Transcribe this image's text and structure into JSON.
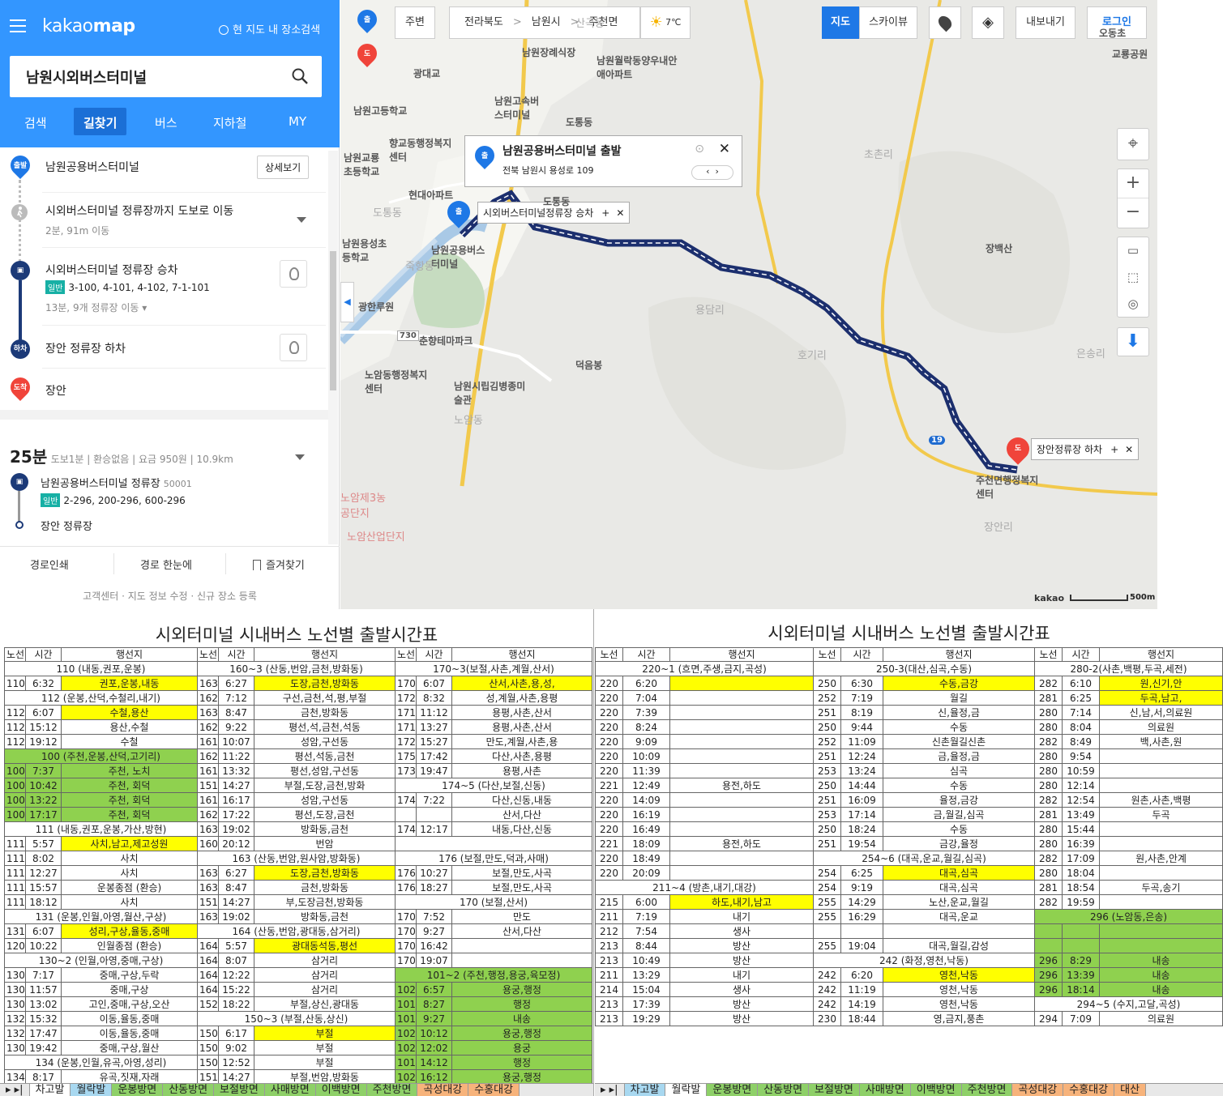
{
  "app": {
    "logo_light": "kakao",
    "logo_bold": "map",
    "here_search": "현 지도 내 장소검색"
  },
  "search": {
    "value": "남원시외버스터미널"
  },
  "tabs": [
    "검색",
    "길찾기",
    "버스",
    "지하철",
    "MY"
  ],
  "route_steps": {
    "start_badge": "출발",
    "start": "남원공용버스터미널",
    "detail_btn": "상세보기",
    "walk": "시외버스터미널 정류장까지 도보로 이동",
    "walk_sub": "2분, 91m 이동",
    "board_badge": "승차",
    "board": "시외버스터미널 정류장 승차",
    "board_type": "일반",
    "board_lines": "3-100,  4-101,  4-102,  7-1-101",
    "board_sub": "13분, 9개 정류장 이동",
    "alight_badge": "하차",
    "alight": "장안 정류장 하차",
    "end_badge": "도착",
    "end": "장안"
  },
  "alt_route": {
    "minutes": "25분",
    "summary": "도보1분 | 환승없음 | 요금 950원 | 10.9km",
    "stop": "남원공용버스터미널 정류장",
    "stop_id": "50001",
    "type": "일반",
    "lines": "2-296, 200-296, 600-296",
    "dest": "장안 정류장"
  },
  "footer": {
    "print": "경로인쇄",
    "overview": "경로 한눈에",
    "fav": "즐겨찾기",
    "links": "고객센터 · 지도 정보 수정 · 신규 장소 등록"
  },
  "map": {
    "btn_start": "출",
    "btn_end": "도",
    "nearby": "주변",
    "crumbs": [
      "전라북도",
      "남원시",
      "주천면"
    ],
    "temp": "7℃",
    "map": "지도",
    "sky": "스카이뷰",
    "export": "내보내기",
    "login": "로그인",
    "popup_title": "남원공용버스터미널 출발",
    "popup_addr": "전북 남원시 용성로 109",
    "tag_board": "시외버스터미널정류장 승차",
    "tag_alight": "장안정류장 하차",
    "labels": [
      "남원장례식장",
      "남원월락동양우내안애아파트",
      "광대교",
      "남원고속버스터미널",
      "남원고등학교",
      "향교동행정복지센터",
      "남원교룡초등학교",
      "도통동",
      "현대아파트",
      "남원용성초등학교",
      "남원공용버스터미널",
      "광한루원",
      "춘향테마파크",
      "노암동행정복지센터",
      "남원시립김병종미술관",
      "덕음봉",
      "용담리",
      "호기리",
      "장백산",
      "주천면행정복지센터",
      "장안리",
      "노암동",
      "도통동",
      "초촌리",
      "오동초",
      "교룡공원",
      "은송리",
      "도통동",
      "죽항동",
      "산곡동",
      "노암제3농공단지",
      "노암산업단지",
      "730",
      "19"
    ],
    "scale": "500m",
    "brand": "kakao"
  },
  "sheets": [
    {
      "title": "시외터미널 시내버스 노선별 출발시간표",
      "tabs": [
        "차고발",
        "월락발",
        "운봉방면",
        "산동방면",
        "보절방면",
        "사매방면",
        "이백방면",
        "주천방면",
        "곡성대강",
        "수홍대강"
      ]
    },
    {
      "title": "시외터미널 시내버스 노선별 출발시간표",
      "tabs": [
        "차고발",
        "월락발",
        "운봉방면",
        "산동방면",
        "보절방면",
        "사매방면",
        "이백방면",
        "주천방면",
        "곡성대강",
        "수홍대강",
        "대산"
      ]
    }
  ],
  "col_headers": [
    "노선",
    "시간",
    "행선지"
  ],
  "t1": [
    [
      "110 (내동,권포,운봉)"
    ],
    [
      "110",
      "6:32",
      "권포,운봉,내동",
      "y"
    ],
    [
      "112 (운봉,산덕,수철리,내기)"
    ],
    [
      "112",
      "6:07",
      "수철,용산",
      "y"
    ],
    [
      "112",
      "15:12",
      "용산,수철"
    ],
    [
      "112",
      "19:12",
      "수철"
    ],
    [
      "100 (주천,운봉,산덕,고기리)",
      "",
      "",
      "g"
    ],
    [
      "100",
      "7:37",
      "주천, 노치",
      "g"
    ],
    [
      "100",
      "10:42",
      "주천, 회덕",
      "g"
    ],
    [
      "100",
      "13:22",
      "주천, 회덕",
      "g"
    ],
    [
      "100",
      "17:17",
      "주천, 회덕",
      "g"
    ],
    [
      "111 (내동,권포,운봉,가산,방현)"
    ],
    [
      "111",
      "5:57",
      "사치,남고,제고성원",
      "y"
    ],
    [
      "111",
      "8:02",
      "사치"
    ],
    [
      "111",
      "12:27",
      "사치"
    ],
    [
      "111",
      "15:57",
      "운봉종점 (환승)"
    ],
    [
      "111",
      "18:12",
      "사치"
    ],
    [
      "131 (운봉,인월,아영,월산,구상)"
    ],
    [
      "131",
      "6:07",
      "성리,구상,율동,중매",
      "y"
    ],
    [
      "120",
      "10:22",
      "인월종점 (환승)"
    ],
    [
      "130~2 (인월,아영,중매,구상)"
    ],
    [
      "130",
      "7:17",
      "중매,구상,두락"
    ],
    [
      "130",
      "11:57",
      "중매,구상"
    ],
    [
      "130",
      "13:02",
      "고인,중매,구상,오산"
    ],
    [
      "132",
      "15:32",
      "이동,율동,중매"
    ],
    [
      "132",
      "17:47",
      "이동,율동,중매"
    ],
    [
      "130",
      "19:42",
      "중매,구상,월산"
    ],
    [
      "134 (운봉,인월,유곡,아영,성리)"
    ],
    [
      "134",
      "8:17",
      "유곡,짓재,자래"
    ]
  ],
  "t2": [
    [
      "160~3 (산동,번암,금천,방화동)"
    ],
    [
      "163",
      "6:27",
      "도장,금천,방화동",
      "y"
    ],
    [
      "162",
      "7:12",
      "구선,금천,석,평,부절"
    ],
    [
      "163",
      "8:47",
      "금천,방화동"
    ],
    [
      "162",
      "9:22",
      "평선,석,금천,석동"
    ],
    [
      "161",
      "10:07",
      "성암,구선동"
    ],
    [
      "162",
      "11:22",
      "평선,석동,금천"
    ],
    [
      "161",
      "13:32",
      "평선,성암,구선동"
    ],
    [
      "151",
      "14:27",
      "부절,도장,금천,방화"
    ],
    [
      "161",
      "16:17",
      "성암,구선동"
    ],
    [
      "162",
      "17:22",
      "평선,도장,금천"
    ],
    [
      "163",
      "19:02",
      "방화동,금천"
    ],
    [
      "160",
      "20:12",
      "번암"
    ],
    [
      "163 (산동,번암,원사암,방화동)"
    ],
    [
      "163",
      "6:27",
      "도장,금천,방화동",
      "y"
    ],
    [
      "163",
      "8:47",
      "금천,방화동"
    ],
    [
      "151",
      "14:27",
      "부,도장금천,방화동"
    ],
    [
      "163",
      "19:02",
      "방화동,금천"
    ],
    [
      "164 (산동,번암,광대동,삼거리)"
    ],
    [
      "164",
      "5:57",
      "광대동석동,평선",
      "y"
    ],
    [
      "164",
      "8:07",
      "삼거리"
    ],
    [
      "164",
      "12:22",
      "삼거리"
    ],
    [
      "164",
      "15:22",
      "삼거리"
    ],
    [
      "152",
      "18:22",
      "부절,상신,광대동"
    ],
    [
      "150~3 (부절,산동,상신)"
    ],
    [
      "150",
      "6:17",
      "부절",
      "y"
    ],
    [
      "150",
      "9:02",
      "부절"
    ],
    [
      "150",
      "12:52",
      "부절"
    ],
    [
      "151",
      "14:27",
      "부절,번암,방화동"
    ]
  ],
  "t3": [
    [
      "170~3(보절,사촌,계월,산서)"
    ],
    [
      "170",
      "6:07",
      "산서,사촌,용,성,",
      "y"
    ],
    [
      "172",
      "8:32",
      "성,계월,사촌,용평"
    ],
    [
      "171",
      "11:12",
      "용평,사촌,산서"
    ],
    [
      "171",
      "13:27",
      "용평,사촌,산서"
    ],
    [
      "172",
      "15:27",
      "만도,계월,사촌,용"
    ],
    [
      "175",
      "17:42",
      "다산,사촌,용평"
    ],
    [
      "173",
      "19:47",
      "용평,사촌"
    ],
    [
      "174~5 (다산,보절,신동)"
    ],
    [
      "174",
      "7:22",
      "다산,신동,내동"
    ],
    [
      "",
      "",
      "산서,다산"
    ],
    [
      "174",
      "12:17",
      "내동,다산,신동"
    ],
    [
      ""
    ],
    [
      "176 (보절,만도,덕과,사매)"
    ],
    [
      "176",
      "10:27",
      "보절,만도,사곡"
    ],
    [
      "176",
      "18:27",
      "보절,만도,사곡"
    ],
    [
      "170 (보절,산서)"
    ],
    [
      "170",
      "7:52",
      "만도"
    ],
    [
      "170",
      "9:27",
      "산서,다산"
    ],
    [
      "170",
      "16:42",
      ""
    ],
    [
      "170",
      "19:07",
      ""
    ],
    [
      "101~2 (주천,행정,용궁,육모정)",
      "",
      "",
      "g"
    ],
    [
      "102",
      "6:57",
      "용궁,행정",
      "g"
    ],
    [
      "101",
      "8:27",
      "행정",
      "g"
    ],
    [
      "101",
      "9:27",
      "내송",
      "g"
    ],
    [
      "102",
      "10:12",
      "용궁,행정",
      "g"
    ],
    [
      "102",
      "12:02",
      "용궁",
      "g"
    ],
    [
      "101",
      "14:12",
      "행정",
      "g"
    ],
    [
      "102",
      "16:12",
      "용궁,행정",
      "g"
    ]
  ],
  "t4": [
    [
      "220~1 (흐면,주생,금지,곡성)"
    ],
    [
      "220",
      "6:20",
      "",
      "yc"
    ],
    [
      "220",
      "7:04",
      ""
    ],
    [
      "220",
      "7:39",
      ""
    ],
    [
      "220",
      "8:24",
      ""
    ],
    [
      "220",
      "9:09",
      ""
    ],
    [
      "220",
      "10:09",
      ""
    ],
    [
      "220",
      "11:39",
      ""
    ],
    [
      "221",
      "12:49",
      "용전,하도"
    ],
    [
      "220",
      "14:09",
      ""
    ],
    [
      "220",
      "16:19",
      ""
    ],
    [
      "220",
      "16:49",
      ""
    ],
    [
      "221",
      "18:09",
      "용전,하도"
    ],
    [
      "220",
      "18:49",
      ""
    ],
    [
      "220",
      "20:09",
      ""
    ],
    [
      "211~4 (방촌,내기,대강)"
    ],
    [
      "215",
      "6:00",
      "하도,내기,남고",
      "y"
    ],
    [
      "211",
      "7:19",
      "내기"
    ],
    [
      "212",
      "7:54",
      "생사"
    ],
    [
      "213",
      "8:44",
      "방산"
    ],
    [
      "213",
      "10:49",
      "방산"
    ],
    [
      "211",
      "13:29",
      "내기"
    ],
    [
      "214",
      "15:04",
      "생사"
    ],
    [
      "213",
      "17:39",
      "방산"
    ],
    [
      "213",
      "19:29",
      "방산"
    ]
  ],
  "t5": [
    [
      "250-3(대산,심곡,수동)"
    ],
    [
      "250",
      "6:30",
      "수동,금강",
      "y"
    ],
    [
      "252",
      "7:19",
      "월길"
    ],
    [
      "251",
      "8:19",
      "신,율정,금"
    ],
    [
      "250",
      "9:44",
      "수동"
    ],
    [
      "252",
      "11:09",
      "신촌월길신촌"
    ],
    [
      "251",
      "12:24",
      "금,율정,금"
    ],
    [
      "253",
      "13:24",
      "심곡"
    ],
    [
      "250",
      "14:44",
      "수동"
    ],
    [
      "251",
      "16:09",
      "율정,금강"
    ],
    [
      "253",
      "17:14",
      "금,월길,심곡"
    ],
    [
      "250",
      "18:24",
      "수동"
    ],
    [
      "251",
      "19:54",
      "금강,율정"
    ],
    [
      "254~6 (대곡,운교,월길,심곡)"
    ],
    [
      "254",
      "6:25",
      "대곡,심곡",
      "y"
    ],
    [
      "254",
      "9:19",
      "대곡,심곡"
    ],
    [
      "255",
      "14:29",
      "노산,운교,월길"
    ],
    [
      "255",
      "16:29",
      "대곡,운교"
    ],
    [
      "",
      ""
    ],
    [
      "255",
      "19:04",
      "대곡,월길,감성"
    ],
    [
      "242 (화정,영천,낙동)"
    ],
    [
      "242",
      "6:20",
      "영천,낙동",
      "y"
    ],
    [
      "242",
      "11:19",
      "영천,낙동"
    ],
    [
      "242",
      "14:19",
      "영천,낙동"
    ],
    [
      "230",
      "18:44",
      "영,금지,풍촌"
    ]
  ],
  "t6": [
    [
      "280-2(사촌,백평,두곡,세전)"
    ],
    [
      "282",
      "6:10",
      "원,신기,안",
      "y"
    ],
    [
      "281",
      "6:25",
      "두곡,남고,",
      "y"
    ],
    [
      "280",
      "7:14",
      "신,남,서,의료원"
    ],
    [
      "280",
      "8:04",
      "의료원"
    ],
    [
      "282",
      "8:49",
      "백,사촌,원"
    ],
    [
      "280",
      "9:54",
      ""
    ],
    [
      "280",
      "10:59",
      ""
    ],
    [
      "280",
      "12:14",
      ""
    ],
    [
      "282",
      "12:54",
      "원촌,사촌,백평"
    ],
    [
      "281",
      "13:49",
      "두곡"
    ],
    [
      "280",
      "15:44",
      ""
    ],
    [
      "280",
      "16:39",
      ""
    ],
    [
      "282",
      "17:09",
      "원,사촌,안계"
    ],
    [
      "280",
      "18:04",
      ""
    ],
    [
      "281",
      "18:54",
      "두곡,송기"
    ],
    [
      "282",
      "19:59",
      ""
    ],
    [
      "296 (노암동,은송)",
      "",
      "",
      "g"
    ],
    [
      "",
      "",
      "",
      "g"
    ],
    [
      "",
      "",
      "",
      "g"
    ],
    [
      "296",
      "8:29",
      "내송",
      "g"
    ],
    [
      "296",
      "13:39",
      "내송",
      "g"
    ],
    [
      "296",
      "18:14",
      "내송",
      "g"
    ],
    [
      "294~5 (수지,고달,곡성)"
    ],
    [
      "294",
      "7:09",
      "의료원"
    ]
  ]
}
